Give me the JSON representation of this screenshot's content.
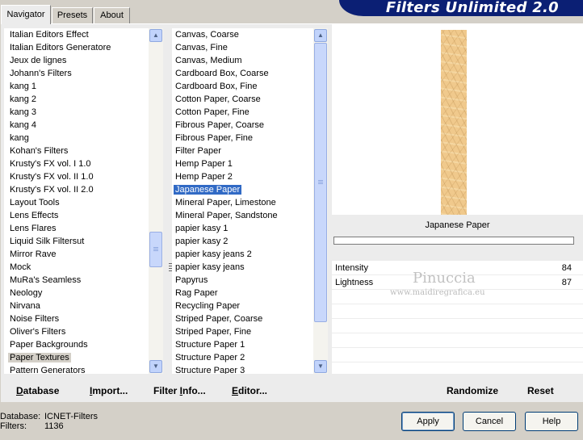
{
  "tabs": [
    "Navigator",
    "Presets",
    "About"
  ],
  "banner_title": "Filters Unlimited 2.0",
  "categories": {
    "items": [
      "Italian Editors Effect",
      "Italian Editors Generatore",
      "Jeux de lignes",
      "Johann's Filters",
      "kang 1",
      "kang 2",
      "kang 3",
      "kang 4",
      "kang",
      "Kohan's Filters",
      "Krusty's FX vol. I 1.0",
      "Krusty's FX vol. II 1.0",
      "Krusty's FX vol. II 2.0",
      "Layout Tools",
      "Lens Effects",
      "Lens Flares",
      "Liquid Silk Filtersut",
      "Mirror Rave",
      "Mock",
      "MuRa's Seamless",
      "Neology",
      "Nirvana",
      "Noise Filters",
      "Oliver's Filters",
      "Paper Backgrounds",
      "Paper Textures",
      "Pattern Generators"
    ],
    "selected": "Paper Textures"
  },
  "filters": {
    "items": [
      "Canvas, Coarse",
      "Canvas, Fine",
      "Canvas, Medium",
      "Cardboard Box, Coarse",
      "Cardboard Box, Fine",
      "Cotton Paper, Coarse",
      "Cotton Paper, Fine",
      "Fibrous Paper, Coarse",
      "Fibrous Paper, Fine",
      "Filter Paper",
      "Hemp Paper 1",
      "Hemp Paper 2",
      "Japanese Paper",
      "Mineral Paper, Limestone",
      "Mineral Paper, Sandstone",
      "papier kasy 1",
      "papier kasy 2",
      "papier kasy jeans 2",
      "papier kasy jeans",
      "Papyrus",
      "Rag Paper",
      "Recycling Paper",
      "Striped Paper, Coarse",
      "Striped Paper, Fine",
      "Structure Paper 1",
      "Structure Paper 2",
      "Structure Paper 3"
    ],
    "selected": "Japanese Paper"
  },
  "preview": {
    "filter_name": "Japanese Paper"
  },
  "params": [
    {
      "name": "Intensity",
      "value": "84"
    },
    {
      "name": "Lightness",
      "value": "87"
    }
  ],
  "watermark": {
    "name": "Pinuccia",
    "url": "www.maidiregrafica.eu"
  },
  "toolbar": {
    "database": "Database",
    "import": "Import...",
    "filter_info": "Filter Info...",
    "editor": "Editor...",
    "randomize": "Randomize",
    "reset": "Reset"
  },
  "footer": {
    "database_label": "Database:",
    "database_value": "ICNET-Filters",
    "filters_label": "Filters:",
    "filters_value": "1136"
  },
  "buttons": {
    "apply": "Apply",
    "cancel": "Cancel",
    "help": "Help"
  }
}
